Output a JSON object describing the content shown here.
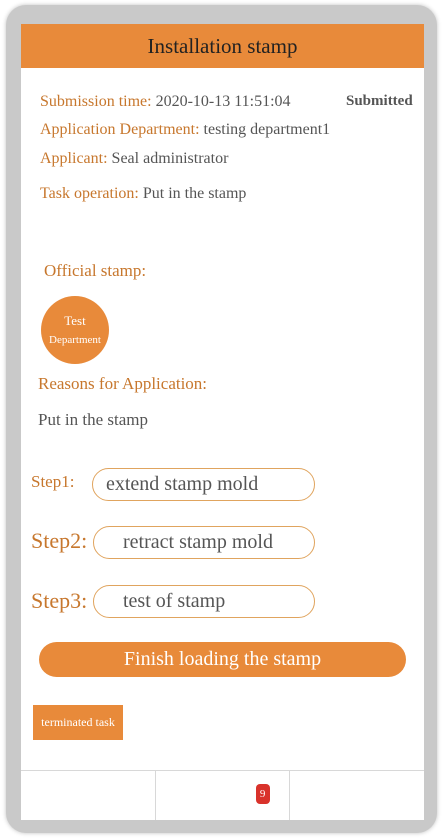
{
  "header": {
    "title": "Installation stamp"
  },
  "status": "Submitted",
  "info": {
    "submission_label": "Submission time:",
    "submission_value": "2020-10-13 11:51:04",
    "department_label": "Application Department:",
    "department_value": "testing department1",
    "applicant_label": "Applicant:",
    "applicant_value": "Seal administrator",
    "operation_label": "Task operation:",
    "operation_value": "Put in the stamp"
  },
  "official_stamp": {
    "label": "Official stamp:",
    "seal_line1": "Test",
    "seal_line2": "Department"
  },
  "reasons": {
    "label": "Reasons for Application:",
    "value": "Put in the stamp"
  },
  "steps": [
    {
      "label": "Step1:",
      "button": "extend stamp mold"
    },
    {
      "label": "Step2:",
      "button": "retract stamp mold"
    },
    {
      "label": "Step3:",
      "button": "test of stamp"
    }
  ],
  "finish_button": "Finish loading the stamp",
  "terminate_button": "terminated task",
  "bottom_bar": {
    "badge_count": "9"
  },
  "colors": {
    "accent": "#e88a3a",
    "label": "#c7772d",
    "badge": "#d9322b"
  }
}
